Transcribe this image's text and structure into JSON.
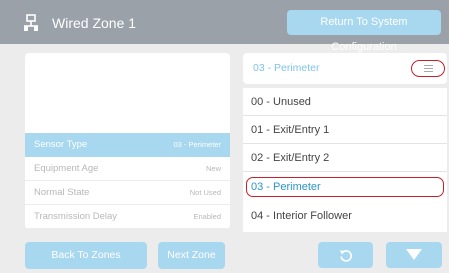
{
  "header": {
    "title": "Wired Zone 1",
    "return_label": "Return To System Configuration",
    "icon": "wired-zone-icon"
  },
  "settings": {
    "rows": [
      {
        "label": "Sensor Type",
        "value": "03 - Perimeter",
        "selected": true
      },
      {
        "label": "Equipment Age",
        "value": "New"
      },
      {
        "label": "Normal State",
        "value": "Not Used"
      },
      {
        "label": "Transmission Delay",
        "value": "Enabled"
      }
    ]
  },
  "nav": {
    "back_label": "Back To Zones",
    "next_label": "Next Zone"
  },
  "selector": {
    "selected_value": "03 - Perimeter",
    "options": [
      "00 - Unused",
      "01 - Exit/Entry 1",
      "02 - Exit/Entry 2",
      "03 - Perimeter",
      "04 - Interior Follower"
    ],
    "current_index": 3
  },
  "controls": {
    "undo_icon": "undo-icon",
    "down_icon": "down-arrow-icon"
  },
  "colors": {
    "header_bg": "#9aa1a9",
    "accent": "#a8d7f0",
    "highlight_text": "#2d95c9",
    "outline_red": "#c8202a",
    "background": "#ececed"
  }
}
